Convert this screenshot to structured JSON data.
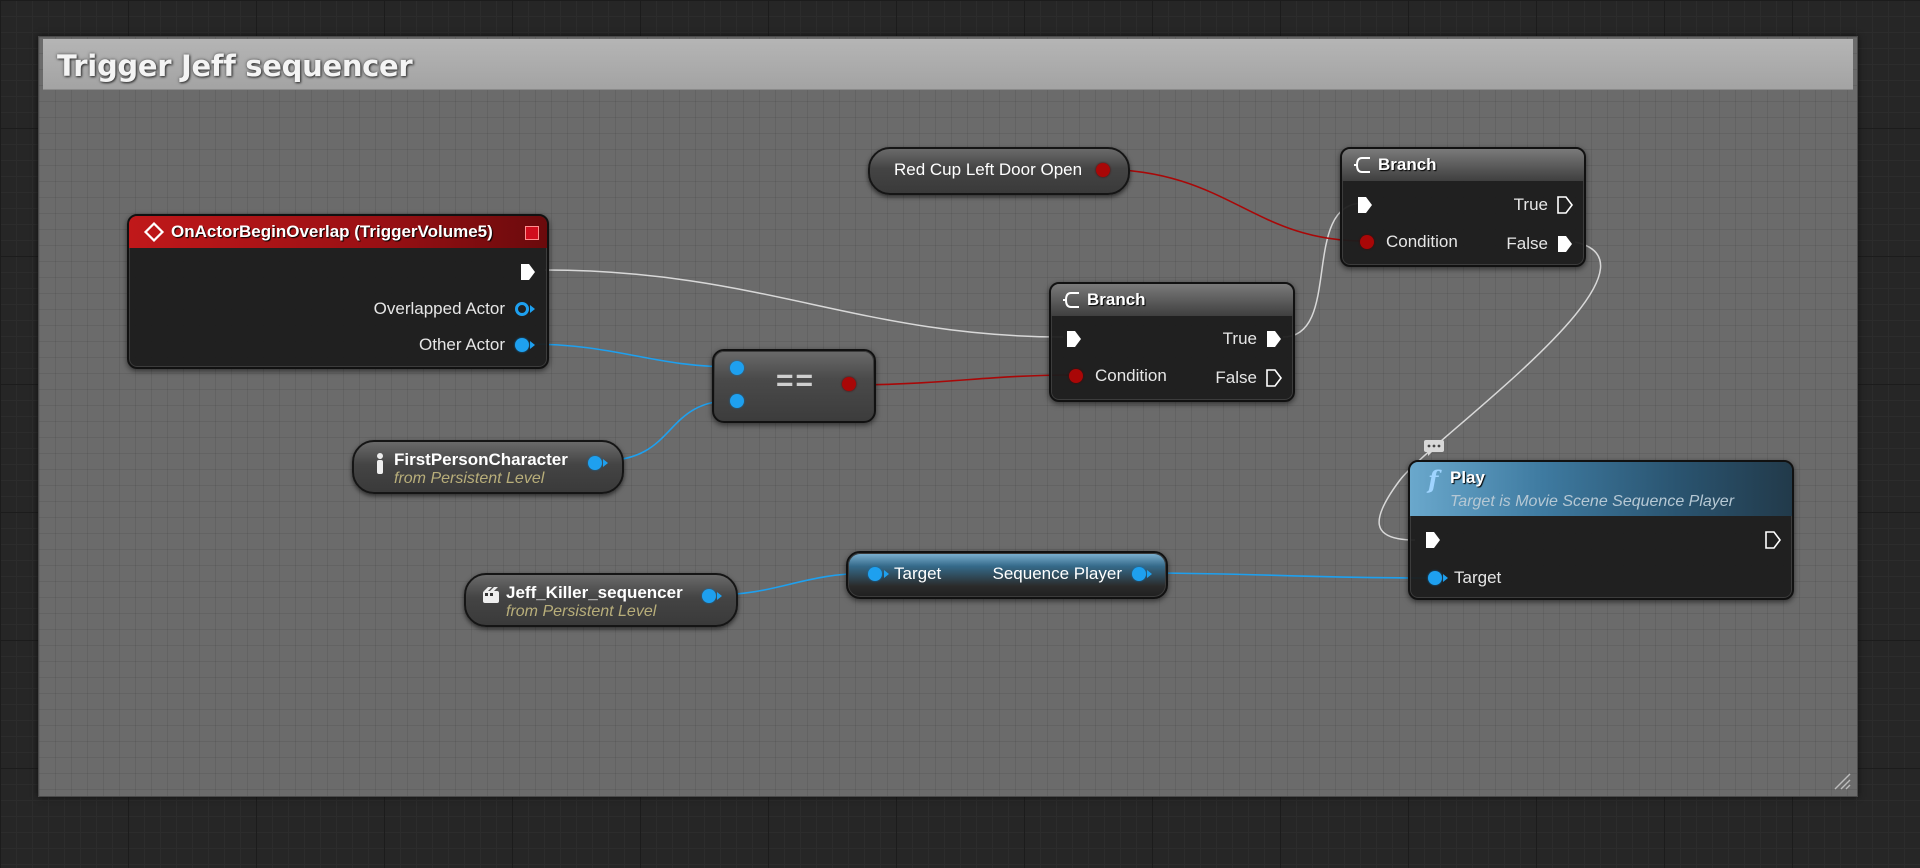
{
  "comment": {
    "title": "Trigger Jeff sequencer"
  },
  "colors": {
    "exec": "#ffffff",
    "object_pin": "#1ea0ef",
    "bool_pin": "#a90707",
    "event_header": "#b01818",
    "function_header": "#4a8db5"
  },
  "event_node": {
    "icon": "event-diamond-icon",
    "title": "OnActorBeginOverlap (TriggerVolume5)",
    "pins": [
      "Overlapped Actor",
      "Other Actor"
    ]
  },
  "equal_node": {
    "label": "=="
  },
  "first_person_ref": {
    "title": "FirstPersonCharacter",
    "subtitle": "from Persistent Level"
  },
  "jeff_ref": {
    "title": "Jeff_Killer_sequencer",
    "subtitle": "from Persistent Level"
  },
  "red_cup_var": {
    "label": "Red Cup Left Door Open"
  },
  "branch_1": {
    "title": "Branch",
    "condition": "Condition",
    "true_label": "True",
    "false_label": "False"
  },
  "branch_2": {
    "title": "Branch",
    "condition": "Condition",
    "true_label": "True",
    "false_label": "False"
  },
  "sequence_getter": {
    "input_label": "Target",
    "output_label": "Sequence Player"
  },
  "play_node": {
    "icon": "function-f-icon",
    "title": "Play",
    "subtitle": "Target is Movie Scene Sequence Player",
    "target_label": "Target"
  }
}
